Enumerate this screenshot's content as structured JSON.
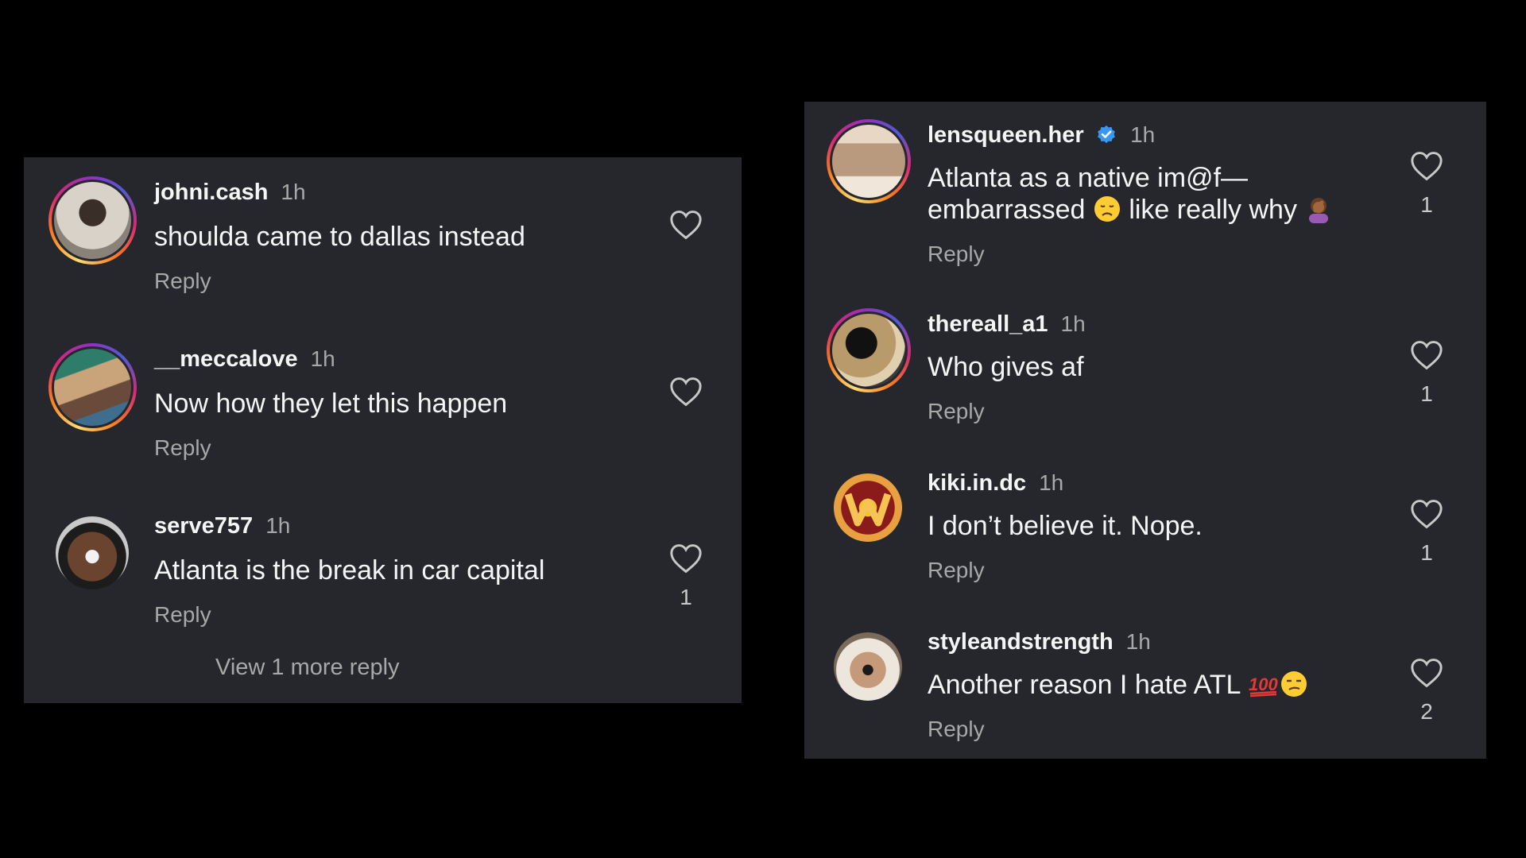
{
  "left_panel": {
    "comments": [
      {
        "username": "johni.cash",
        "time": "1h",
        "text": "shoulda came to dallas instead",
        "reply": "Reply",
        "likes": ""
      },
      {
        "username": "__meccalove",
        "time": "1h",
        "text": "Now how they let this happen",
        "reply": "Reply",
        "likes": ""
      },
      {
        "username": "serve757",
        "time": "1h",
        "text": "Atlanta is the break in car capital",
        "reply": "Reply",
        "likes": "1"
      }
    ],
    "view_more": "View 1 more reply"
  },
  "right_panel": {
    "comments": [
      {
        "username": "lensqueen.her",
        "verified": true,
        "time": "1h",
        "text_line1": "Atlanta as a native im@f—",
        "text_line2": "embarrassed",
        "text_line2b": "like really why",
        "reply": "Reply",
        "likes": "1"
      },
      {
        "username": "thereall_a1",
        "time": "1h",
        "text": "Who gives af",
        "reply": "Reply",
        "likes": "1"
      },
      {
        "username": "kiki.in.dc",
        "time": "1h",
        "text": "I don’t believe it. Nope.",
        "reply": "Reply",
        "likes": "1"
      },
      {
        "username": "styleandstrength",
        "time": "1h",
        "text": "Another reason I hate ATL",
        "reply": "Reply",
        "likes": "2"
      }
    ]
  },
  "icons": {
    "heart": "heart-outline-icon",
    "verified": "verified-badge-icon",
    "emoji_sad": "disappointed-face-emoji",
    "emoji_facepalm": "woman-facepalming-emoji",
    "emoji_100": "hundred-points-emoji",
    "emoji_unamused": "unamused-face-emoji"
  },
  "colors": {
    "panel_bg": "#25272c",
    "page_bg": "#000000",
    "muted_text": "#a8a8a8",
    "verified_blue": "#3897f0"
  }
}
